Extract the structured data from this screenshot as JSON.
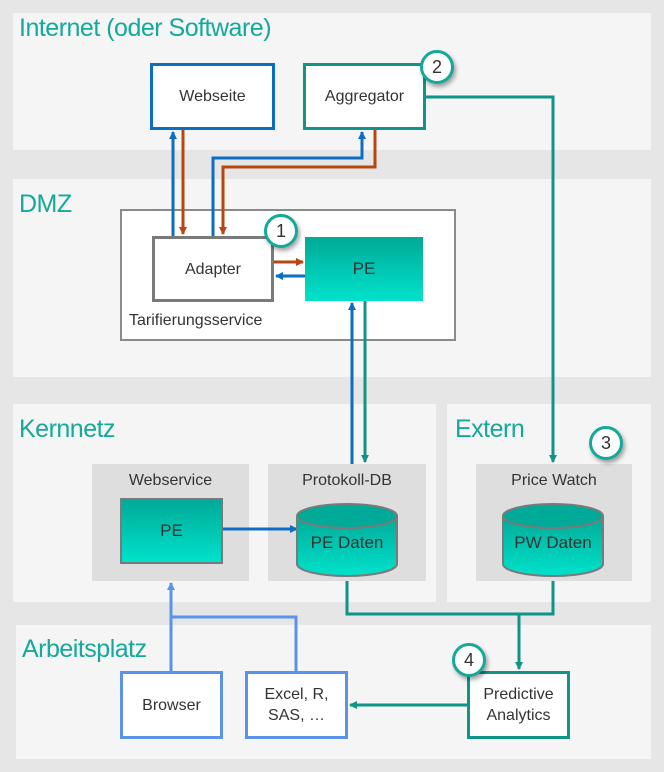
{
  "zones": {
    "internet": "Internet (oder Software)",
    "dmz": "DMZ",
    "kernnetz": "Kernnetz",
    "extern": "Extern",
    "arbeitsplatz": "Arbeitsplatz"
  },
  "nodes": {
    "webseite": "Webseite",
    "aggregator": "Aggregator",
    "adapter": "Adapter",
    "pe_dmz": "PE",
    "tarifierungsservice": "Tarifierungsservice",
    "webservice_label": "Webservice",
    "pe_webservice": "PE",
    "protokoll_db_label": "Protokoll-DB",
    "pe_daten": "PE Daten",
    "price_watch_label": "Price Watch",
    "pw_daten": "PW Daten",
    "browser": "Browser",
    "excel_line1": "Excel, R,",
    "excel_line2": "SAS, …",
    "predictive_line1": "Predictive",
    "predictive_line2": "Analytics"
  },
  "badges": [
    "1",
    "2",
    "3",
    "4"
  ],
  "colors": {
    "accent_teal": "#14a99a",
    "connector_blue": "#0a6fc2",
    "connector_orange": "#b8460e",
    "connector_teal": "#0f9485",
    "connector_light_blue": "#5b93e8"
  }
}
